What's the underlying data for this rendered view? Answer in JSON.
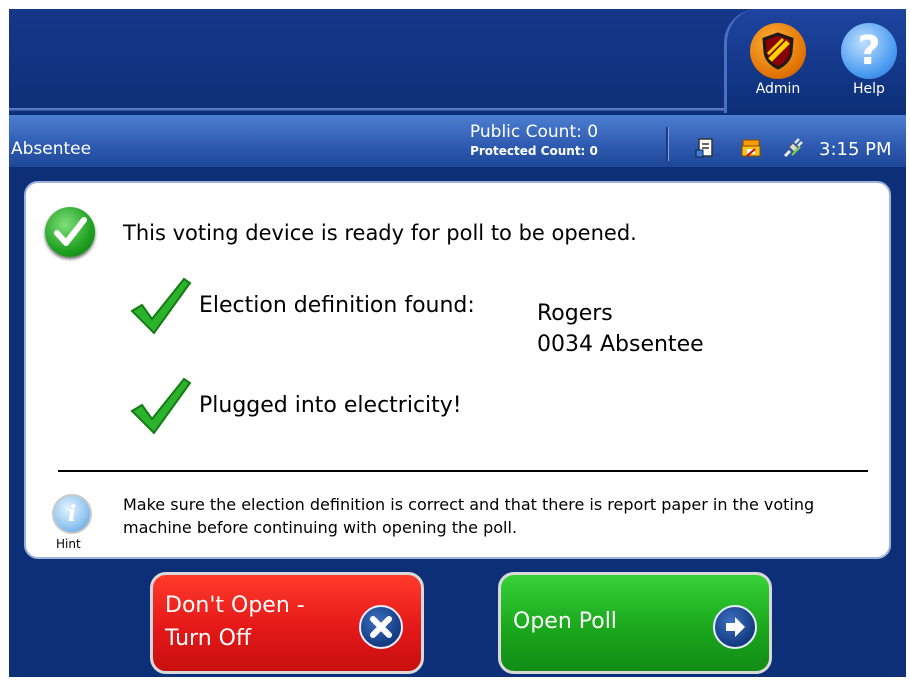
{
  "header": {
    "admin_label": "Admin",
    "help_label": "Help"
  },
  "status": {
    "mode": "Absentee",
    "public_count": "Public Count: 0",
    "protected_count": "Protected Count: 0",
    "time": "3:15 PM",
    "icons": [
      "report-icon",
      "printer-icon",
      "power-plug-icon"
    ]
  },
  "main": {
    "ready_message": "This voting device is ready for poll to be opened.",
    "definition_label": "Election definition found:",
    "definition_name_line1": "Rogers",
    "definition_name_line2": "0034 Absentee",
    "power_message": "Plugged into electricity!",
    "hint_label": "Hint",
    "hint_text": "Make sure the election definition is correct and that there is report paper in the voting machine before continuing with opening the poll."
  },
  "buttons": {
    "dont_open_line1": "Don't Open -",
    "dont_open_line2": "Turn Off",
    "open_poll": "Open Poll"
  },
  "colors": {
    "background": "#0d2f78",
    "danger": "#e41818",
    "success": "#1aa81c",
    "admin_orange": "#e07000",
    "help_blue": "#4a9af0"
  }
}
